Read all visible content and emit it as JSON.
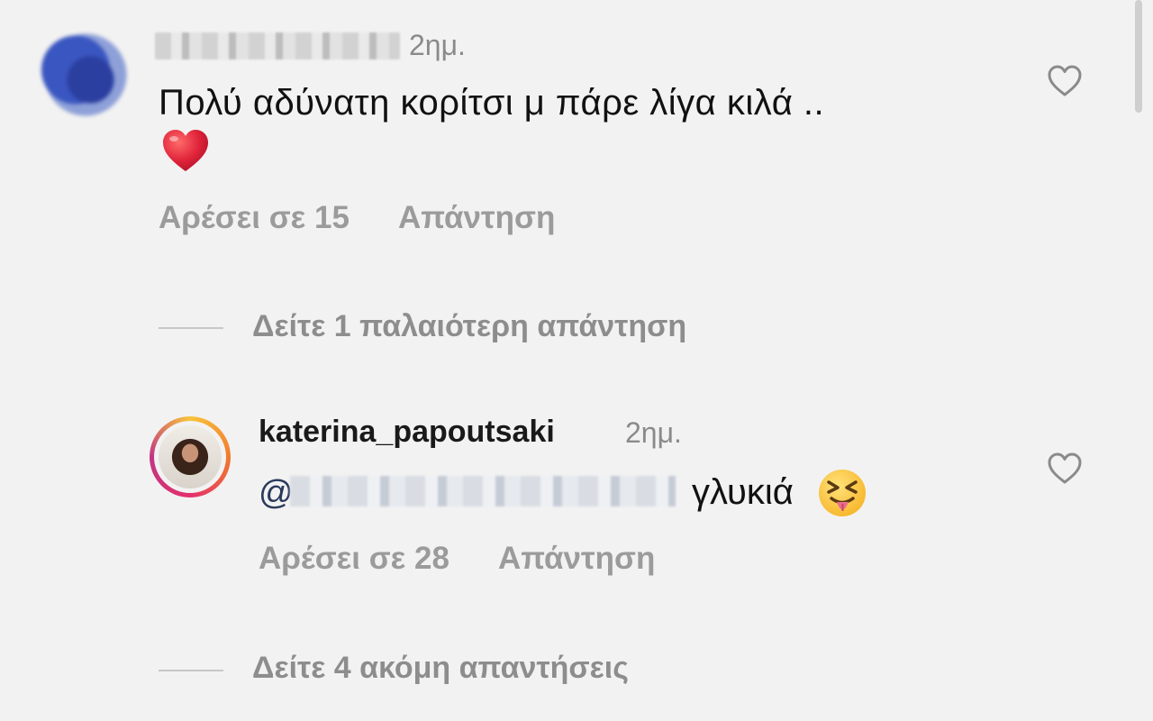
{
  "comment": {
    "time": "2ημ.",
    "text": "Πολύ αδύνατη κορίτσι μ πάρε λίγα κιλά ..",
    "likes_label": "Αρέσει σε 15",
    "reply_label": "Απάντηση",
    "emoji": "heart-emoji"
  },
  "view_older": {
    "label": "Δείτε 1 παλαιότερη απάντηση"
  },
  "reply": {
    "username": "katerina_papoutsaki",
    "time": "2ημ.",
    "mention_prefix": "@",
    "text": "γλυκιά",
    "likes_label": "Αρέσει σε 28",
    "reply_label": "Απάντηση",
    "emoji": "squinting-tongue-emoji"
  },
  "view_more": {
    "label": "Δείτε 4 ακόμη απαντήσεις"
  },
  "colors": {
    "background": "#f2f2f2",
    "secondary_text": "#8d8d8d",
    "heart_red": "#e0243a",
    "story_ring": [
      "#f9c33b",
      "#e4306c",
      "#c13584"
    ]
  }
}
